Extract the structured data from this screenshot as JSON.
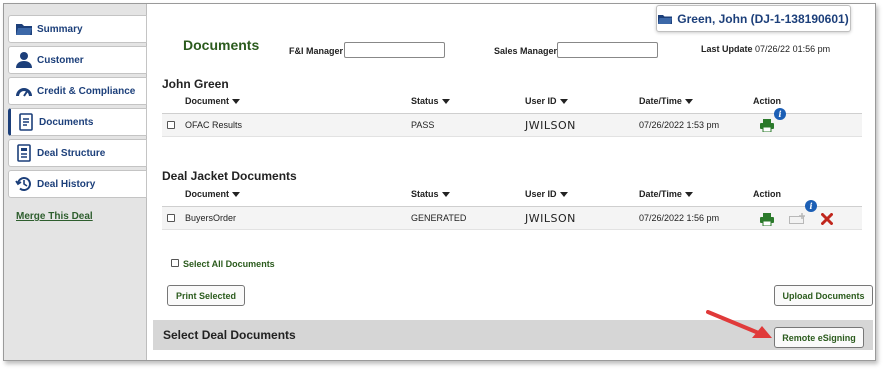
{
  "sidebar": {
    "items": [
      {
        "label": "Summary",
        "icon": "folder-icon"
      },
      {
        "label": "Customer",
        "icon": "person-icon"
      },
      {
        "label": "Credit & Compliance",
        "icon": "gauge-icon"
      },
      {
        "label": "Documents",
        "icon": "document-icon"
      },
      {
        "label": "Deal Structure",
        "icon": "structure-icon"
      },
      {
        "label": "Deal History",
        "icon": "history-icon"
      }
    ],
    "merge_link": "Merge This Deal"
  },
  "deal_chip": "Green, John (DJ-1-138190601)",
  "header": {
    "title": "Documents",
    "fi_manager_label": "F&I Manager",
    "fi_manager_value": "",
    "sales_manager_label": "Sales Manager",
    "sales_manager_value": "",
    "last_update_label": "Last Update",
    "last_update_value": "07/26/22 01:56 pm"
  },
  "columns": [
    "Document",
    "Status",
    "User ID",
    "Date/Time",
    "Action"
  ],
  "sections": [
    {
      "title": "John Green",
      "rows": [
        {
          "document": "OFAC Results",
          "status": "PASS",
          "user_id": "JWILSON",
          "datetime": "07/26/2022 1:53 pm"
        }
      ]
    },
    {
      "title": "Deal Jacket Documents",
      "rows": [
        {
          "document": "BuyersOrder",
          "status": "GENERATED",
          "user_id": "JWILSON",
          "datetime": "07/26/2022 1:56 pm"
        }
      ]
    }
  ],
  "select_all_label": "Select All Documents",
  "buttons": {
    "print_selected": "Print Selected",
    "upload_documents": "Upload Documents",
    "remote_esigning": "Remote eSigning"
  },
  "footer_title": "Select Deal Documents",
  "colors": {
    "accent_blue": "#1c3f7a",
    "accent_green": "#2b5b1d",
    "arrow_red": "#e03a3a"
  }
}
